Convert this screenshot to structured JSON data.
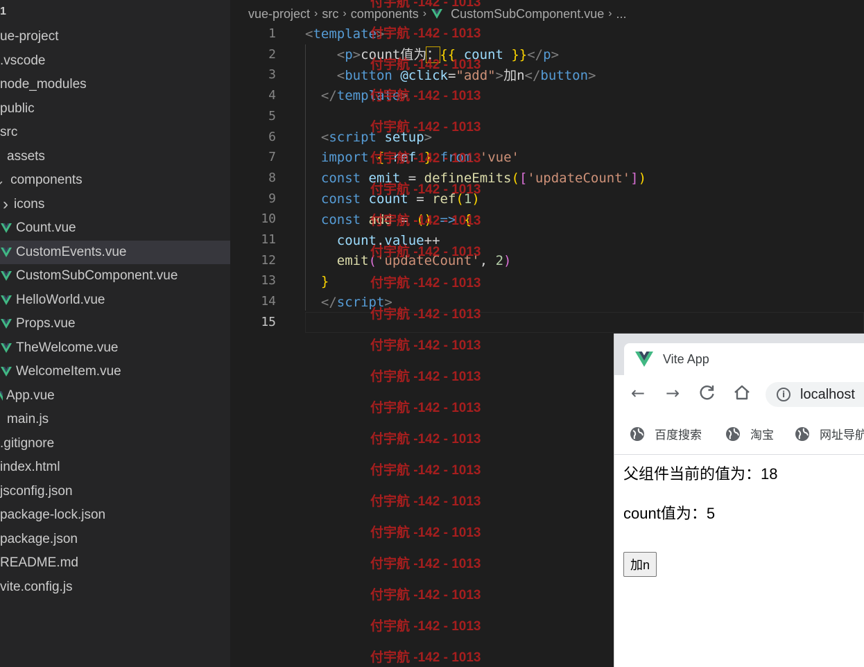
{
  "explorer": {
    "items": [
      {
        "label": "1",
        "kind": "header"
      },
      {
        "label": "ue-project",
        "kind": "folder"
      },
      {
        "label": ".vscode",
        "kind": "folder"
      },
      {
        "label": "node_modules",
        "kind": "folder"
      },
      {
        "label": "public",
        "kind": "folder"
      },
      {
        "label": "src",
        "kind": "folder"
      },
      {
        "label": "assets",
        "kind": "folder"
      },
      {
        "label": "components",
        "kind": "folder-open"
      },
      {
        "label": "icons",
        "kind": "folder-collapsed"
      },
      {
        "label": "Count.vue",
        "kind": "vue"
      },
      {
        "label": "CustomEvents.vue",
        "kind": "vue",
        "selected": true
      },
      {
        "label": "CustomSubComponent.vue",
        "kind": "vue"
      },
      {
        "label": "HelloWorld.vue",
        "kind": "vue"
      },
      {
        "label": "Props.vue",
        "kind": "vue"
      },
      {
        "label": "TheWelcome.vue",
        "kind": "vue"
      },
      {
        "label": "WelcomeItem.vue",
        "kind": "vue"
      },
      {
        "label": "App.vue",
        "kind": "vue-partial"
      },
      {
        "label": "main.js",
        "kind": "file"
      },
      {
        "label": ".gitignore",
        "kind": "file"
      },
      {
        "label": "index.html",
        "kind": "file"
      },
      {
        "label": "jsconfig.json",
        "kind": "file"
      },
      {
        "label": "package-lock.json",
        "kind": "file"
      },
      {
        "label": "package.json",
        "kind": "file"
      },
      {
        "label": "README.md",
        "kind": "file"
      },
      {
        "label": "vite.config.js",
        "kind": "file"
      }
    ]
  },
  "breadcrumb": {
    "parts": [
      "vue-project",
      "src",
      "components",
      "CustomSubComponent.vue",
      "..."
    ],
    "separator": "›"
  },
  "editor": {
    "line_numbers": [
      "1",
      "2",
      "3",
      "4",
      "5",
      "6",
      "7",
      "8",
      "9",
      "10",
      "11",
      "12",
      "13",
      "14",
      "15"
    ],
    "active_line": "15",
    "string_line3": "\"add\"",
    "string_vue": "'vue'",
    "string_update": "'updateCount'",
    "text_count_label": "count值为",
    "text_button": "加n",
    "number_one": "1",
    "number_two": "2"
  },
  "watermark": {
    "text": "付宇航 -142 - 1013",
    "color": "#c81e1e"
  },
  "browser": {
    "tab_title": "Vite App",
    "tab_close": "×",
    "url": "localhost",
    "bookmarks": [
      "百度搜索",
      "淘宝",
      "网址导航"
    ],
    "content": {
      "parent_line": "父组件当前的值为：18",
      "child_line": "count值为：5",
      "button_label": "加n"
    }
  },
  "colors": {
    "sidebar_bg": "#252526",
    "editor_bg": "#1e1e1e",
    "vue_green": "#41b883",
    "vue_dark": "#35495e"
  }
}
